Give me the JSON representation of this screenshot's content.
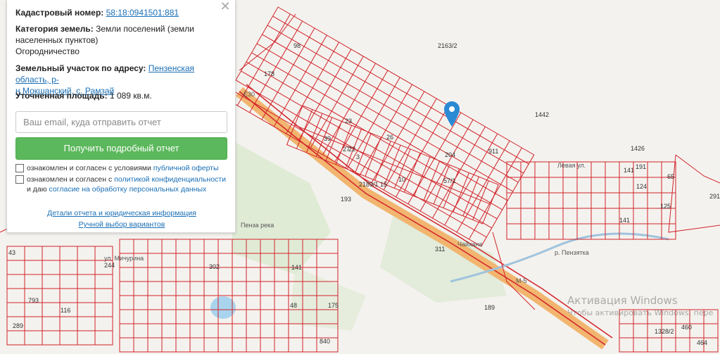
{
  "panel": {
    "cadastral_label": "Кадастровый номер:",
    "cadastral_value": "58:18:0941501:881",
    "category_label": "Категория земель:",
    "category_value_line1": "Земли поселений (земли",
    "category_value_line2": "населенных пунктов)",
    "category_value_line3": "Огородничество",
    "address_label": "Земельный участок по адресу:",
    "address_value_line1": "Пензенская область, р-",
    "address_value_line2": "н Мокшанский, с. Рамзай",
    "area_label": "Уточненная площадь:",
    "area_value": "1 089 кв.м.",
    "email_placeholder": "Ваш email, куда отправить отчет",
    "submit_label": "Получить подробный отчет",
    "consent1_text": "ознакомлен и согласен с условиями",
    "consent1_link": "публичной оферты",
    "consent2_text1": "ознакомлен и согласен с",
    "consent2_link1": "политикой конфиденциальности",
    "consent2_text2": "и даю",
    "consent2_link2": "согласие на обработку персональных данных",
    "details_link": "Детали отчета и юридическая информация",
    "manual_link": "Ручной выбор вариантов",
    "close_glyph": "✕"
  },
  "map": {
    "parcel_labels": [
      "2163/2",
      "1442",
      "1426",
      "911",
      "204",
      "57/1",
      "2189/1",
      "193",
      "189",
      "141",
      "124",
      "65",
      "125",
      "141",
      "291",
      "48",
      "175",
      "302",
      "244",
      "793",
      "289",
      "116",
      "840",
      "43",
      "1328/2",
      "460",
      "464",
      "178",
      "98",
      "39",
      "27",
      "23",
      "15",
      "10",
      "26",
      "3",
      "311",
      "141",
      "191",
      "22"
    ],
    "road_labels": [
      "E30",
      "M-5",
      "Пенза река",
      "р. Пензятка",
      "Чайхана",
      "ул. Мичурина",
      "Левая ул."
    ],
    "overlay_texts": [
      "Активация Windows",
      "Чтобы активировать Windows, пере"
    ]
  },
  "colors": {
    "accent_green": "#5cb85c",
    "link_blue": "#1a6fb5",
    "parcel_red": "#d2232a",
    "road_orange": "#f2a65a",
    "pin_blue": "#2a8ad4"
  }
}
